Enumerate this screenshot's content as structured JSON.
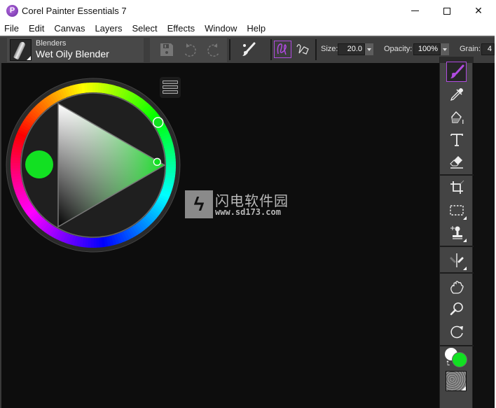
{
  "window": {
    "title": "Corel Painter Essentials 7",
    "app_icon": "corel-painter-icon",
    "controls": {
      "minimize": "–",
      "maximize": "□",
      "close": "✕"
    }
  },
  "menubar": {
    "items": [
      "File",
      "Edit",
      "Canvas",
      "Layers",
      "Select",
      "Effects",
      "Window",
      "Help"
    ]
  },
  "toolbar": {
    "brush_category": "Blenders",
    "brush_variant": "Wet Oily Blender",
    "icons": {
      "save": "save-icon",
      "undo": "undo-icon",
      "redo": "redo-icon",
      "brush_controls": "brush-controls-icon",
      "freehand": "freehand-stroke-icon",
      "straight": "straight-line-stroke-icon"
    },
    "size_label": "Size:",
    "size_value": "20.0",
    "opacity_label": "Opacity:",
    "opacity_value": "100%",
    "grain_label": "Grain:",
    "grain_value": "4"
  },
  "color_wheel": {
    "selected_color": "#12e022",
    "hue_degrees": 125,
    "saturation": 0.93,
    "value": 0.88
  },
  "watermark": {
    "title": "闪电软件园",
    "url": "www.sd173.com"
  },
  "toolbox": {
    "tools": [
      {
        "name": "brush",
        "icon": "brush-icon",
        "active": true
      },
      {
        "name": "dropper",
        "icon": "dropper-icon",
        "active": false
      },
      {
        "name": "paint-bucket",
        "icon": "paint-bucket-icon",
        "active": false
      },
      {
        "name": "text",
        "icon": "text-icon",
        "active": false
      },
      {
        "name": "eraser",
        "icon": "eraser-icon",
        "active": false
      },
      {
        "name": "crop",
        "icon": "crop-icon",
        "active": false
      },
      {
        "name": "rectangular-selection",
        "icon": "selection-rect-icon",
        "active": false
      },
      {
        "name": "clone",
        "icon": "clone-stamp-icon",
        "active": false
      },
      {
        "name": "mirror",
        "icon": "mirror-painting-icon",
        "active": false
      },
      {
        "name": "grabber",
        "icon": "hand-icon",
        "active": false
      },
      {
        "name": "magnifier",
        "icon": "magnifier-icon",
        "active": false
      },
      {
        "name": "rotate-page",
        "icon": "rotate-icon",
        "active": false
      }
    ],
    "main_color": "#12e022",
    "additional_color": "#ffffff"
  }
}
